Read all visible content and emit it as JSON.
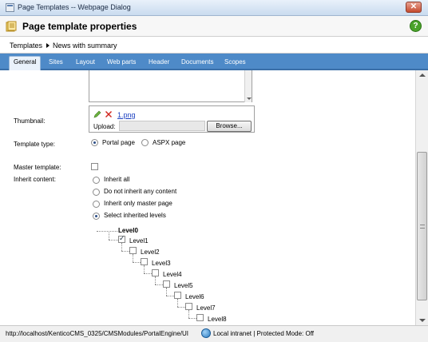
{
  "window": {
    "title": "Page Templates -- Webpage Dialog",
    "close_label": "✕"
  },
  "header": {
    "title": "Page template properties",
    "help_label": "?"
  },
  "breadcrumb": {
    "items": [
      "Templates",
      "News with summary"
    ]
  },
  "tabs": [
    {
      "label": "General",
      "active": true
    },
    {
      "label": "Sites"
    },
    {
      "label": "Layout"
    },
    {
      "label": "Web parts"
    },
    {
      "label": "Header"
    },
    {
      "label": "Documents"
    },
    {
      "label": "Scopes"
    }
  ],
  "form": {
    "thumbnail_label": "Thumbnail:",
    "thumbnail_file": "1.png",
    "upload_label": "Upload:",
    "browse_label": "Browse...",
    "template_type_label": "Template type:",
    "template_type_options": [
      {
        "label": "Portal page",
        "selected": true
      },
      {
        "label": "ASPX page",
        "selected": false
      }
    ],
    "master_template_label": "Master template:",
    "master_template_checked": false,
    "inherit_content_label": "Inherit content:",
    "inherit_options": [
      {
        "label": "Inherit all",
        "selected": false
      },
      {
        "label": "Do not inherit any content",
        "selected": false
      },
      {
        "label": "Inherit only master page",
        "selected": false
      },
      {
        "label": "Select inherited levels",
        "selected": true
      }
    ],
    "levels": [
      {
        "label": "Level0",
        "checked": false
      },
      {
        "label": "Level1",
        "checked": true
      },
      {
        "label": "Level2",
        "checked": false
      },
      {
        "label": "Level3",
        "checked": false
      },
      {
        "label": "Level4",
        "checked": false
      },
      {
        "label": "Level5",
        "checked": false
      },
      {
        "label": "Level6",
        "checked": false
      },
      {
        "label": "Level7",
        "checked": false
      },
      {
        "label": "Level8",
        "checked": false
      }
    ]
  },
  "status": {
    "url": "http://localhost/KenticoCMS_0325/CMSModules/PortalEngine/UI",
    "zone": "Local intranet | Protected Mode: Off"
  }
}
